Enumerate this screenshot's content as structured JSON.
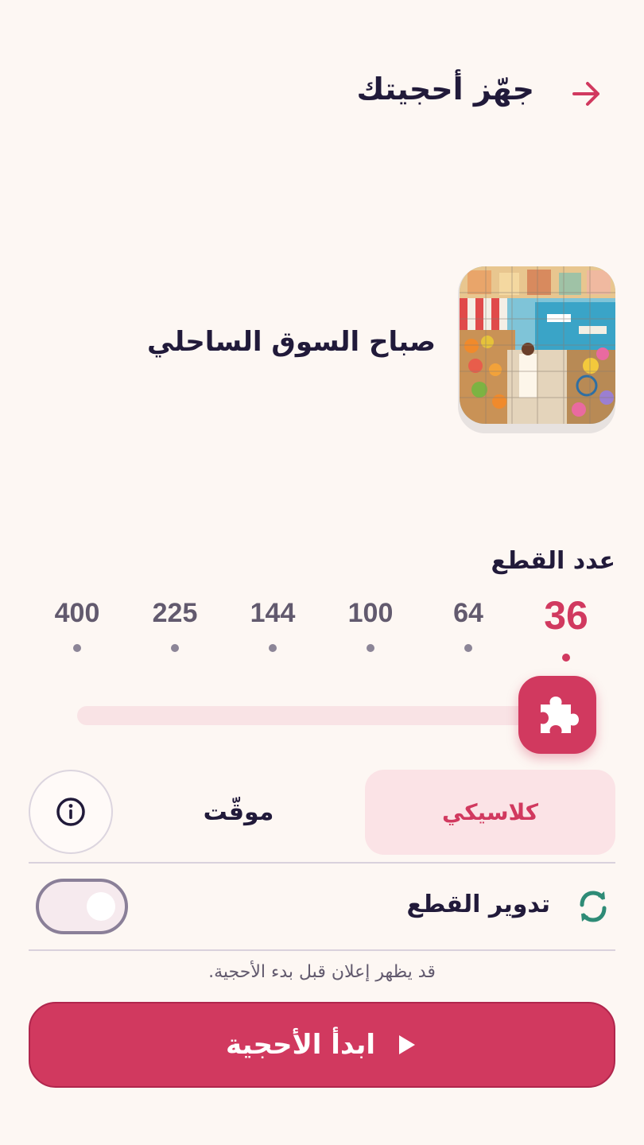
{
  "header": {
    "title": "جهّز أحجيتك",
    "back_icon": "arrow-right-icon"
  },
  "puzzle": {
    "name": "صباح السوق الساحلي"
  },
  "pieces": {
    "label": "عدد القطع",
    "options": [
      "36",
      "64",
      "100",
      "144",
      "225",
      "400"
    ],
    "selected": "36"
  },
  "modes": {
    "classic": "كلاسيكي",
    "timed": "موقّت",
    "active": "كلاسيكي"
  },
  "rotation": {
    "label": "تدوير القطع",
    "enabled": false
  },
  "ad_note": "قد يظهر إعلان قبل بدء الأحجية.",
  "start_button": {
    "label": "ابدأ الأحجية"
  },
  "colors": {
    "accent": "#d1395f",
    "background": "#fdf7f3",
    "rotate_icon": "#2e8b76"
  }
}
